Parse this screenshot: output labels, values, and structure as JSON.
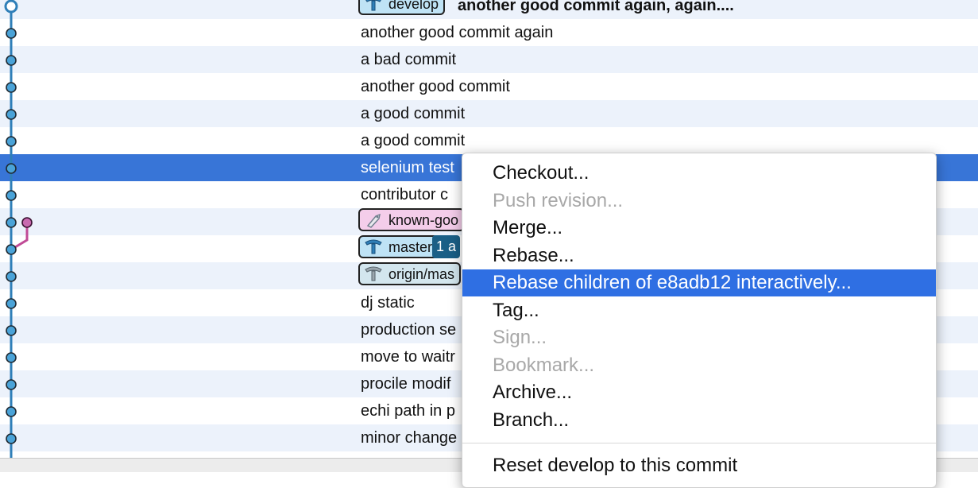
{
  "colors": {
    "graph_line": "#2f7fb8",
    "node_fill": "#4aa3d8",
    "branch_line": "#c04a96",
    "selection": "#3875d7",
    "menu_highlight": "#2f6fe3"
  },
  "commits": [
    {
      "message": "another good commit again, again....",
      "bold": true,
      "badge": {
        "type": "develop",
        "label": "develop",
        "icon": "branch-icon"
      }
    },
    {
      "message": "another good commit again"
    },
    {
      "message": "a bad commit"
    },
    {
      "message": "another  good commit"
    },
    {
      "message": "a good commit"
    },
    {
      "message": "a good commit"
    },
    {
      "message": "selenium test",
      "selected": true
    },
    {
      "message": "contributor c"
    },
    {
      "message": "",
      "badge": {
        "type": "tag",
        "label": "known-goo",
        "icon": "tag-icon"
      }
    },
    {
      "message": "",
      "badge": {
        "type": "branch",
        "label": "master",
        "icon": "branch-icon",
        "ahead": "1 a"
      }
    },
    {
      "message": "",
      "badge": {
        "type": "remote",
        "label": "origin/mas",
        "icon": "remote-branch-icon"
      }
    },
    {
      "message": "dj static"
    },
    {
      "message": "production se"
    },
    {
      "message": "move to waitr"
    },
    {
      "message": "procile modif"
    },
    {
      "message": "echi path in p"
    },
    {
      "message": "minor change"
    }
  ],
  "context_menu": {
    "items": [
      {
        "label": "Checkout...",
        "enabled": true
      },
      {
        "label": "Push revision...",
        "enabled": false
      },
      {
        "label": "Merge...",
        "enabled": true
      },
      {
        "label": "Rebase...",
        "enabled": true
      },
      {
        "label": "Rebase children of e8adb12 interactively...",
        "enabled": true,
        "highlighted": true
      },
      {
        "label": "Tag...",
        "enabled": true
      },
      {
        "label": "Sign...",
        "enabled": false
      },
      {
        "label": "Bookmark...",
        "enabled": false
      },
      {
        "label": "Archive...",
        "enabled": true
      },
      {
        "label": "Branch...",
        "enabled": true
      },
      {
        "separator": true
      },
      {
        "label": "Reset develop to this commit",
        "enabled": true
      }
    ]
  }
}
